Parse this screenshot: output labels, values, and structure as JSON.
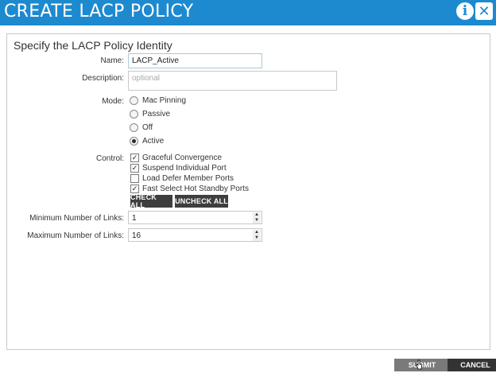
{
  "header": {
    "title": "CREATE LACP POLICY",
    "info_icon": "i",
    "close_icon": "✕",
    "accent_color": "#1d8ad0"
  },
  "form": {
    "section_title": "Specify the LACP Policy Identity",
    "name_label": "Name:",
    "name_value": "LACP_Active",
    "description_label": "Description:",
    "description_placeholder": "optional",
    "mode_label": "Mode:",
    "mode_options": [
      "Mac Pinning",
      "Passive",
      "Off",
      "Active"
    ],
    "mode_selected": "Active",
    "control_label": "Control:",
    "control_options": [
      {
        "label": "Graceful Convergence",
        "checked": true
      },
      {
        "label": "Suspend Individual Port",
        "checked": true
      },
      {
        "label": "Load Defer Member Ports",
        "checked": false
      },
      {
        "label": "Fast Select Hot Standby Ports",
        "checked": true
      }
    ],
    "check_all_label": "CHECK ALL",
    "uncheck_all_label": "UNCHECK ALL",
    "min_links_label": "Minimum Number of Links:",
    "min_links_value": "1",
    "max_links_label": "Maximum Number of Links:",
    "max_links_value": "16"
  },
  "footer": {
    "submit_label": "SUBMIT",
    "cancel_label": "CANCEL"
  }
}
